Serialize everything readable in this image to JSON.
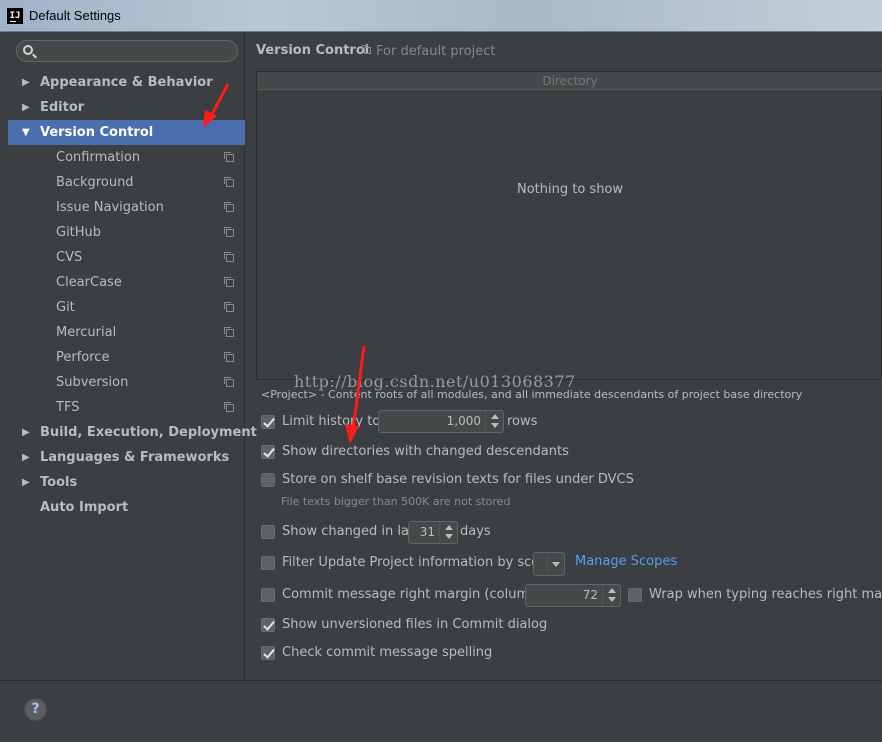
{
  "window": {
    "title": "Default Settings",
    "app_icon_text": "IJ"
  },
  "search": {
    "placeholder": "",
    "value": ""
  },
  "sidebar": {
    "items": [
      {
        "label": "Appearance & Behavior",
        "level": 0,
        "expandable": true,
        "expanded": false
      },
      {
        "label": "Editor",
        "level": 0,
        "expandable": true,
        "expanded": false
      },
      {
        "label": "Version Control",
        "level": 0,
        "expandable": true,
        "expanded": true,
        "selected": true
      },
      {
        "label": "Confirmation",
        "level": 1
      },
      {
        "label": "Background",
        "level": 1
      },
      {
        "label": "Issue Navigation",
        "level": 1
      },
      {
        "label": "GitHub",
        "level": 1
      },
      {
        "label": "CVS",
        "level": 1
      },
      {
        "label": "ClearCase",
        "level": 1
      },
      {
        "label": "Git",
        "level": 1
      },
      {
        "label": "Mercurial",
        "level": 1
      },
      {
        "label": "Perforce",
        "level": 1
      },
      {
        "label": "Subversion",
        "level": 1
      },
      {
        "label": "TFS",
        "level": 1
      },
      {
        "label": "Build, Execution, Deployment",
        "level": 0,
        "expandable": true,
        "expanded": false
      },
      {
        "label": "Languages & Frameworks",
        "level": 0,
        "expandable": true,
        "expanded": false
      },
      {
        "label": "Tools",
        "level": 0,
        "expandable": true,
        "expanded": false
      },
      {
        "label": "Auto Import",
        "level": 0,
        "expandable": false
      }
    ]
  },
  "content": {
    "title": "Version Control",
    "scope": "For default project",
    "table": {
      "header": "Directory",
      "empty_text": "Nothing to show"
    },
    "hint": "<Project> - Content roots of all modules, and all immediate descendants of project base directory",
    "watermark": "http://blog.csdn.net/u013068377",
    "options": {
      "limit_history": {
        "label": "Limit history to:",
        "checked": true,
        "value": "1,000",
        "suffix": "rows"
      },
      "show_directories": {
        "label": "Show directories with changed descendants",
        "checked": true
      },
      "store_on_shelf": {
        "label": "Store on shelf base revision texts for files under DVCS",
        "checked": false,
        "note": "File texts bigger than 500K are not stored"
      },
      "show_changed": {
        "label": "Show changed in last",
        "checked": false,
        "value": "31",
        "suffix": "days"
      },
      "filter_update": {
        "label": "Filter Update Project information by scope",
        "checked": false,
        "link": "Manage Scopes"
      },
      "commit_margin": {
        "label": "Commit message right margin (columns):",
        "checked": false,
        "value": "72"
      },
      "wrap_typing": {
        "label": "Wrap when typing reaches right margin",
        "checked": false
      },
      "show_unversioned": {
        "label": "Show unversioned files in Commit dialog",
        "checked": true
      },
      "check_spelling": {
        "label": "Check commit message spelling",
        "checked": true
      }
    }
  },
  "footer": {
    "help_label": "?"
  },
  "colors": {
    "background": "#3c3f41",
    "selection": "#4b6eaf",
    "link": "#589df6",
    "annotation": "#ff1a1a"
  }
}
